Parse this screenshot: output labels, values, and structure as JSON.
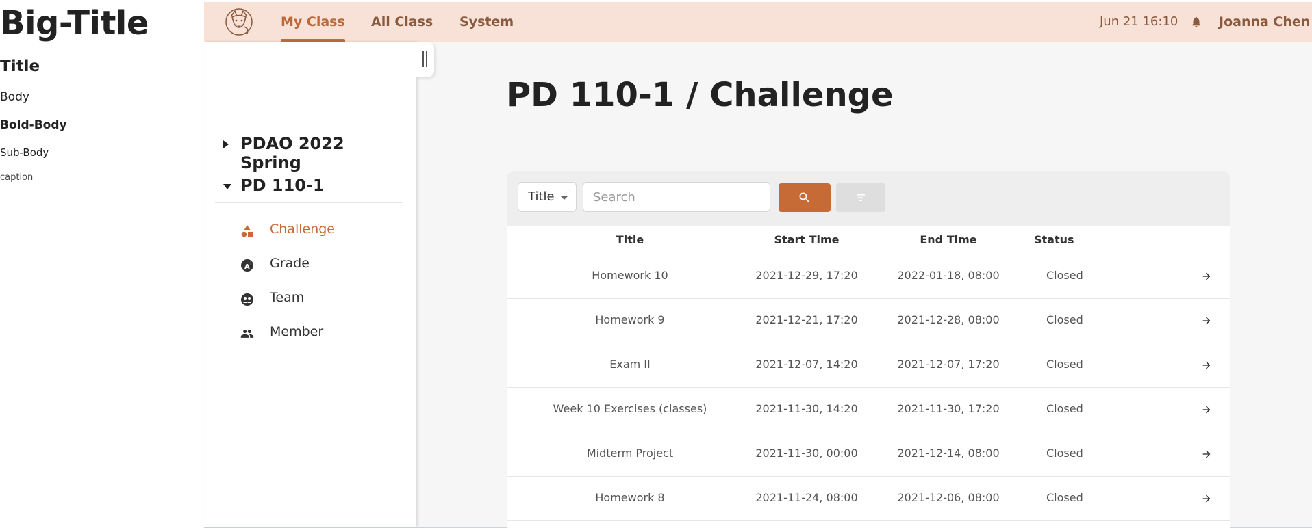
{
  "legend": {
    "big_title": "Big-Title",
    "title": "Title",
    "body": "Body",
    "bold_body": "Bold-Body",
    "sub_body": "Sub-Body",
    "caption": "caption"
  },
  "topbar": {
    "logo_icon": "fox-logo-icon",
    "nav": [
      "My Class",
      "All Class",
      "System"
    ],
    "active_nav": "My Class",
    "datetime": "Jun 21 16:10",
    "bell_icon": "bell-icon",
    "user": "Joanna Chen"
  },
  "sidebar": {
    "groups": [
      {
        "label": "PDAO 2022 Spring",
        "expanded": false
      },
      {
        "label": "PD 110-1",
        "expanded": true
      }
    ],
    "items": [
      {
        "label": "Challenge",
        "icon": "shapes-icon",
        "active": true
      },
      {
        "label": "Grade",
        "icon": "grade-icon",
        "active": false
      },
      {
        "label": "Team",
        "icon": "team-icon",
        "active": false
      },
      {
        "label": "Member",
        "icon": "people-icon",
        "active": false
      }
    ]
  },
  "main": {
    "title": "PD 110-1 / Challenge",
    "filter_select": "Title",
    "search_placeholder": "Search",
    "columns": [
      "Title",
      "Start Time",
      "End Time",
      "Status"
    ],
    "rows": [
      {
        "title": "Homework 10",
        "start": "2021-12-29, 17:20",
        "end": "2022-01-18, 08:00",
        "status": "Closed"
      },
      {
        "title": "Homework 9",
        "start": "2021-12-21, 17:20",
        "end": "2021-12-28, 08:00",
        "status": "Closed"
      },
      {
        "title": "Exam II",
        "start": "2021-12-07, 14:20",
        "end": "2021-12-07, 17:20",
        "status": "Closed"
      },
      {
        "title": "Week 10 Exercises (classes)",
        "start": "2021-11-30, 14:20",
        "end": "2021-11-30, 17:20",
        "status": "Closed"
      },
      {
        "title": "Midterm Project",
        "start": "2021-11-30, 00:00",
        "end": "2021-12-14, 08:00",
        "status": "Closed"
      },
      {
        "title": "Homework 8",
        "start": "2021-11-24, 08:00",
        "end": "2021-12-06, 08:00",
        "status": "Closed"
      }
    ]
  },
  "colors": {
    "accent": "#c66b36",
    "topbar_bg": "#f8e1d6",
    "nav_text": "#8a5a3e"
  }
}
